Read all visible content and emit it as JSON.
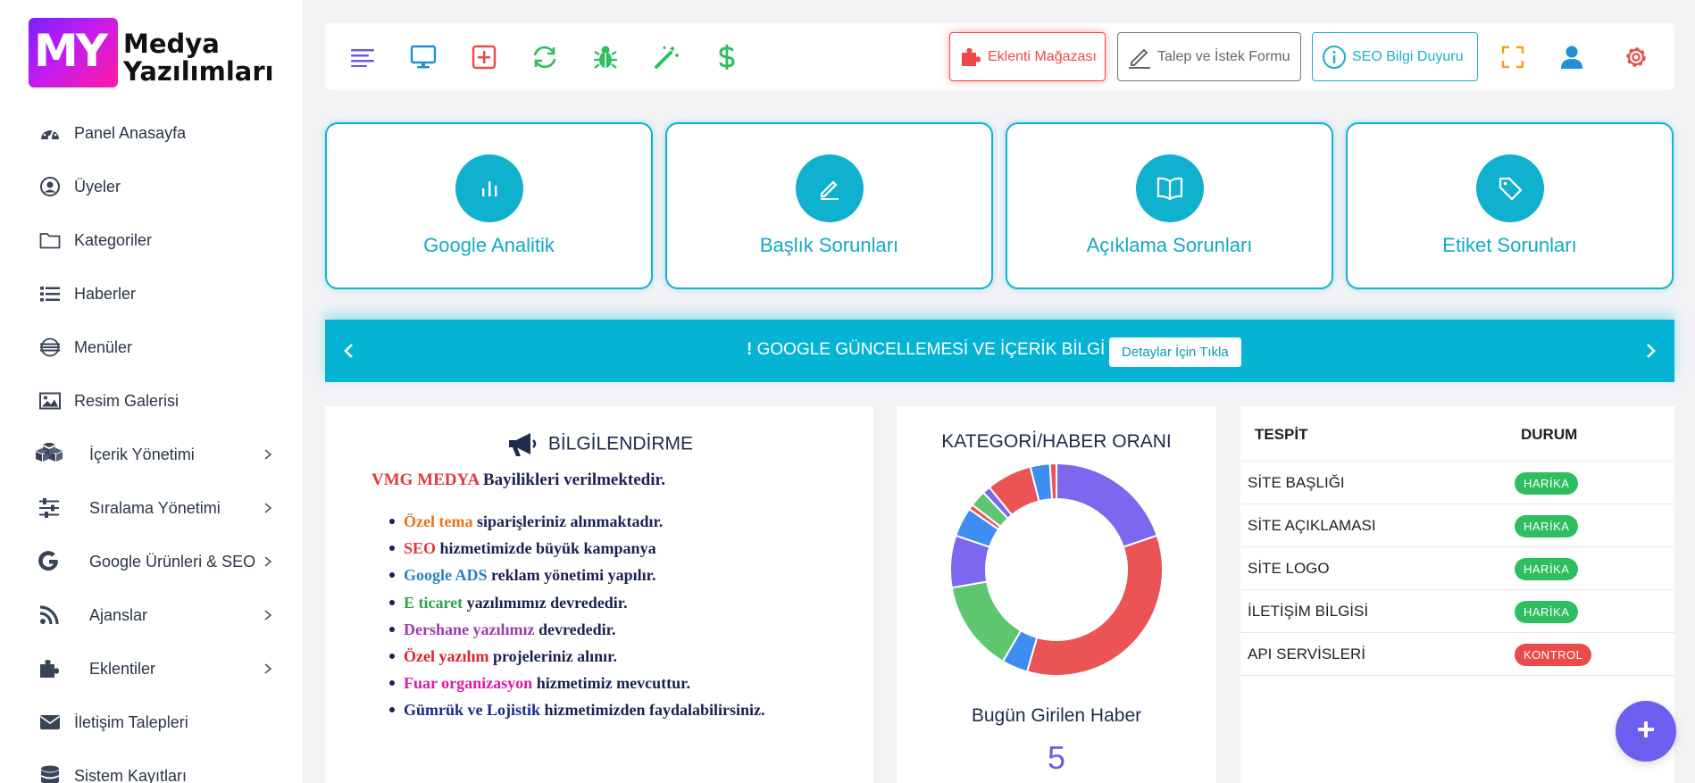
{
  "logo": {
    "mark": "MY",
    "line1": "Medya",
    "line2": "Yazılımları"
  },
  "sidebar": {
    "items": [
      {
        "label": "Panel Anasayfa",
        "icon": "dashboard-icon",
        "chevron": false
      },
      {
        "label": "Üyeler",
        "icon": "user-circle-icon",
        "chevron": false
      },
      {
        "label": "Kategoriler",
        "icon": "folder-icon",
        "chevron": false
      },
      {
        "label": "Haberler",
        "icon": "list-icon",
        "chevron": false
      },
      {
        "label": "Menüler",
        "icon": "menu-globe-icon",
        "chevron": false
      },
      {
        "label": "Resim Galerisi",
        "icon": "image-icon",
        "chevron": false
      },
      {
        "label": "İçerik Yönetimi",
        "icon": "cubes-icon",
        "chevron": true
      },
      {
        "label": "Sıralama Yönetimi",
        "icon": "sliders-icon",
        "chevron": true
      },
      {
        "label": "Google Ürünleri & SEO",
        "icon": "google-icon",
        "chevron": true
      },
      {
        "label": "Ajanslar",
        "icon": "rss-icon",
        "chevron": true
      },
      {
        "label": "Eklentiler",
        "icon": "puzzle-icon",
        "chevron": true
      },
      {
        "label": "İletişim Talepleri",
        "icon": "envelope-icon",
        "chevron": false
      },
      {
        "label": "Sistem Kayıtları",
        "icon": "database-icon",
        "chevron": false
      }
    ]
  },
  "topbar": {
    "icons": [
      "menu-lines-icon",
      "monitor-icon",
      "plus-square-icon",
      "refresh-icon",
      "bug-icon",
      "magic-wand-icon",
      "dollar-icon"
    ],
    "store_label": "Eklenti Mağazası",
    "form_label": "Talep ve İstek Formu",
    "seo_label": "SEO Bilgi Duyuru",
    "right_icons": [
      "fullscreen-icon",
      "user-icon",
      "settings-icon"
    ]
  },
  "cards": [
    {
      "title": "Google Analitik",
      "icon": "bar-chart-icon"
    },
    {
      "title": "Başlık Sorunları",
      "icon": "pencil-icon"
    },
    {
      "title": "Açıklama Sorunları",
      "icon": "book-icon"
    },
    {
      "title": "Etiket Sorunları",
      "icon": "tag-icon"
    }
  ],
  "banner": {
    "text": "GOOGLE GÜNCELLEMESİ VE İÇERİK BİLGİ",
    "button": "Detaylar İçin Tıkla"
  },
  "info": {
    "title": "BİLGİLENDİRME",
    "head_highlight": "VMG MEDYA",
    "head_rest": " Bayilikleri verilmektedir.",
    "items": [
      {
        "hl": "Özel tema",
        "rest": " siparişleriniz alınmaktadır.",
        "color": "#e8731a"
      },
      {
        "hl": "SEO",
        "rest": " hizmetimizde büyük kampanya",
        "color": "#e23a3a"
      },
      {
        "hl": "Google ADS",
        "rest": " reklam yönetimi yapılır.",
        "color": "#2d7fc0"
      },
      {
        "hl": "E ticaret",
        "rest": " yazılımımız devrededir.",
        "color": "#2ea24a"
      },
      {
        "hl": "Dershane yazılımız",
        "rest": " devrededir.",
        "color": "#9b3bb0"
      },
      {
        "hl": "Özel yazılım",
        "rest": " projeleriniz alınır.",
        "color": "#e0202a"
      },
      {
        "hl": "Fuar organizasyon",
        "rest": " hizmetimiz mevcuttur.",
        "color": "#d81aa8"
      },
      {
        "hl": "Gümrük ve Lojistik",
        "rest": " hizmetimizden faydalabilirsiniz.",
        "color": "#1a2a8a"
      }
    ]
  },
  "chart_panel": {
    "title": "KATEGORİ/HABER ORANI",
    "sub": "Bugün Girilen Haber",
    "count": "5"
  },
  "chart_data": {
    "type": "pie",
    "title": "KATEGORİ/HABER ORANI",
    "donut": true,
    "values": [
      20,
      35,
      4,
      14,
      8,
      4.5,
      0.8,
      2.5,
      1.2,
      7,
      3,
      1
    ],
    "colors": [
      "#7b68ee",
      "#ea5455",
      "#3d8ef0",
      "#5ec66e",
      "#7b68ee",
      "#3d8ef0",
      "#ea5455",
      "#5ec66e",
      "#7b68ee",
      "#ea5455",
      "#3d8ef0",
      "#ea5455"
    ]
  },
  "status": {
    "col1": "TESPİT",
    "col2": "DURUM",
    "rows": [
      {
        "name": "SİTE BAŞLIĞI",
        "badge": "HARİKA",
        "color": "#2ebe5f"
      },
      {
        "name": "SİTE AÇIKLAMASI",
        "badge": "HARİKA",
        "color": "#2ebe5f"
      },
      {
        "name": "SİTE LOGO",
        "badge": "HARİKA",
        "color": "#2ebe5f"
      },
      {
        "name": "İLETİŞİM BİLGİSİ",
        "badge": "HARİKA",
        "color": "#2ebe5f"
      },
      {
        "name": "API SERVİSLERİ",
        "badge": "KONTROL",
        "color": "#ea4a4a"
      }
    ]
  },
  "fab_icon": "plus-icon"
}
